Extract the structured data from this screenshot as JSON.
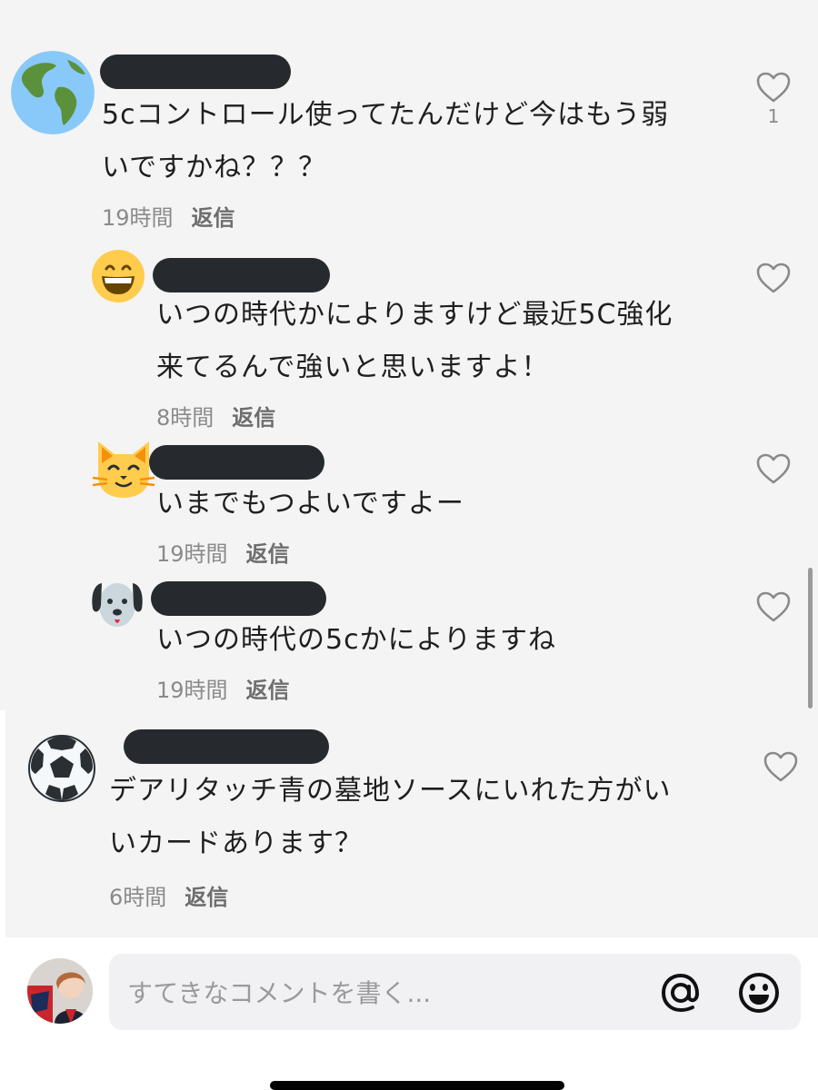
{
  "comments": [
    {
      "text": "5cコントロール使ってたんだけど今はもう弱\nいですかね？？？",
      "time": "19時間",
      "reply_label": "返信",
      "like_count": "1",
      "avatar_icon": "earth-globe-icon"
    },
    {
      "text": "いつの時代かによりますけど最近5C強化\n来てるんで強いと思いますよ！",
      "time": "8時間",
      "reply_label": "返信",
      "avatar_icon": "grinning-face-icon"
    },
    {
      "text": "いまでもつよいですよー",
      "time": "19時間",
      "reply_label": "返信",
      "avatar_icon": "cat-face-icon"
    },
    {
      "text": "いつの時代の5cかによりますね",
      "time": "19時間",
      "reply_label": "返信",
      "avatar_icon": "dog-face-icon"
    },
    {
      "text": "デアリタッチ青の墓地ソースにいれた方がい\nいカードあります？",
      "time": "6時間",
      "reply_label": "返信",
      "avatar_icon": "soccer-ball-icon"
    }
  ],
  "composer": {
    "placeholder": "すてきなコメントを書く...",
    "mention_icon": "at-sign-icon",
    "emoji_icon": "smiley-face-icon"
  },
  "colors": {
    "background": "#f4f4f4",
    "redaction": "#262a2e",
    "secondary_text": "#8a8a8a"
  }
}
